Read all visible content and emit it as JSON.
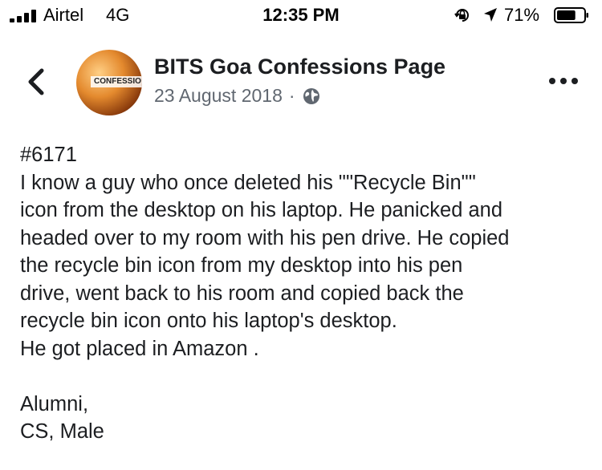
{
  "status_bar": {
    "carrier": "Airtel",
    "network": "4G",
    "time": "12:35 PM",
    "battery_percent": "71%",
    "battery_level": 0.71,
    "icons": [
      "signal-icon",
      "orientation-lock-icon",
      "location-icon",
      "battery-icon"
    ]
  },
  "post": {
    "page_name": "BITS Goa Confessions Page",
    "date": "23 August 2018",
    "separator": "·",
    "avatar_text": "CONFESSIO",
    "privacy_icon": "globe-icon",
    "lines": [
      "#6171",
      "I know a guy who once deleted his \"\"Recycle Bin\"\"",
      "icon from the desktop on his laptop. He panicked and",
      "headed over to my room with his pen drive. He copied",
      "the recycle bin icon from my desktop into his pen",
      "drive, went back to his room and copied back the",
      "recycle bin icon onto his laptop's desktop.",
      "He got placed in Amazon .",
      "",
      "Alumni,",
      "CS, Male"
    ]
  },
  "colors": {
    "text": "#1c1e21",
    "secondary_text": "#606770",
    "background": "#ffffff"
  }
}
